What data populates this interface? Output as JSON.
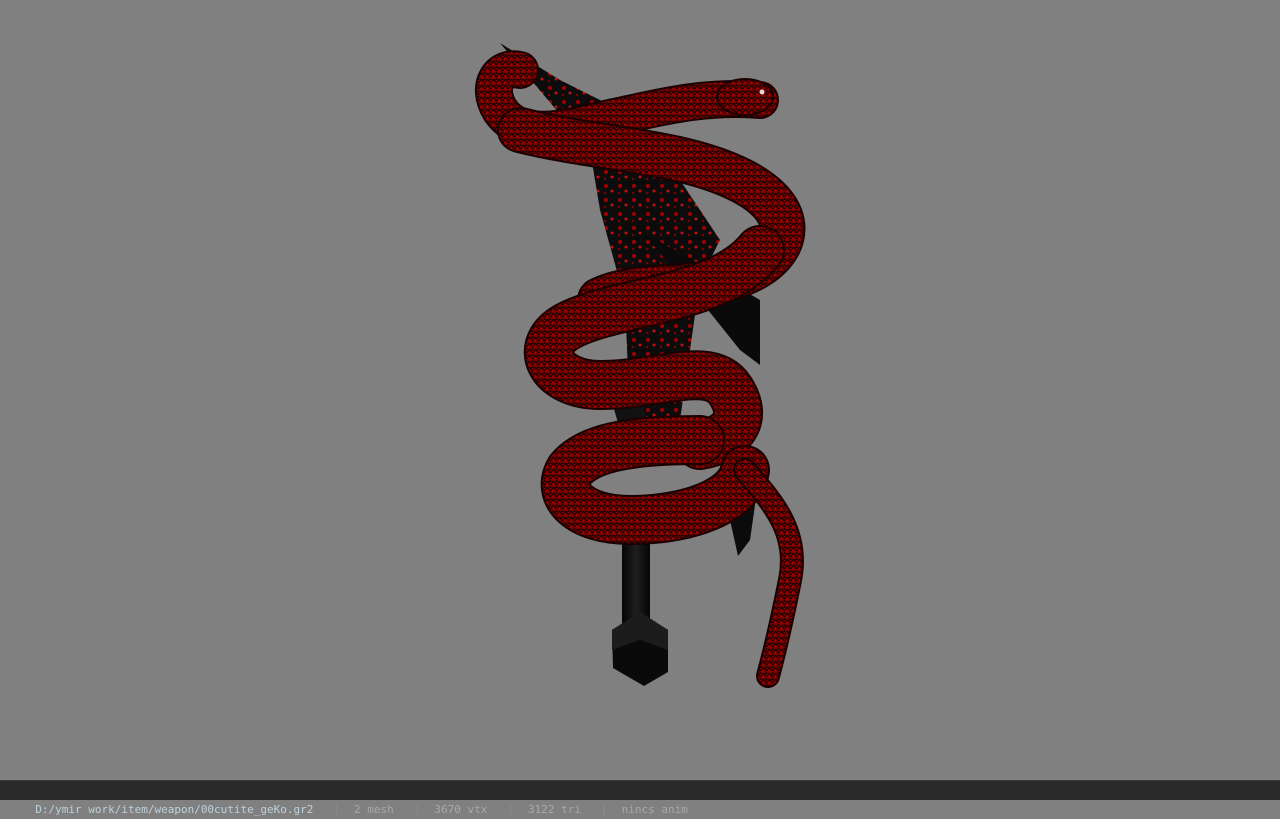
{
  "statusbar": {
    "file_path": "D:/ymir work/item/weapon/00cutite_geKo.gr2",
    "mesh_count": "2 mesh",
    "vertex_count": "3670 vtx",
    "triangle_count": "3122 tri",
    "animation": "nincs anim",
    "separator": "|"
  },
  "viewport": {
    "background_color": "#808080",
    "model_icon": "serpent-dagger-model"
  },
  "colors": {
    "snake_red": "#8b0000",
    "blade_black": "#0a0a0a",
    "status_bg": "#2a2a2a"
  }
}
